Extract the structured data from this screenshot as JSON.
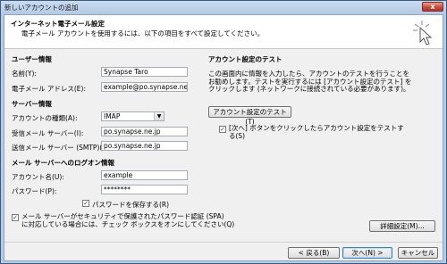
{
  "window": {
    "title": "新しいアカウントの追加",
    "close_label": "x"
  },
  "header": {
    "title": "インターネット電子メール設定",
    "description": "電子メール アカウントを使用するには、以下の項目をすべて設定してください。"
  },
  "user_info": {
    "heading": "ユーザー情報",
    "name_label": "名前(Y):",
    "name_value": "Synapse Taro",
    "email_label": "電子メール アドレス(E):",
    "email_value": "example@po.synapse.ne.jp"
  },
  "server_info": {
    "heading": "サーバー情報",
    "account_type_label": "アカウントの種類(A):",
    "account_type_value": "IMAP",
    "incoming_label": "受信メール サーバー(I):",
    "incoming_value": "po.synapse.ne.jp",
    "outgoing_label": "送信メール サーバー (SMTP)(O):",
    "outgoing_value": "po.synapse.ne.jp"
  },
  "login_info": {
    "heading": "メール サーバーへのログオン情報",
    "account_name_label": "アカウント名(U):",
    "account_name_value": "example",
    "password_label": "パスワード(P):",
    "password_value": "********",
    "remember_label": "パスワードを保存する(R)",
    "remember_checked": true,
    "spa_line1": "メール サーバーがセキュリティで保護されたパスワード認証 (SPA)",
    "spa_line2": "に対応している場合には、チェック ボックスをオンにしてください(Q)",
    "spa_checked": true
  },
  "test": {
    "heading": "アカウント設定のテスト",
    "desc_line1": "この画面内に情報を入力したら、アカウントのテストを行うことを",
    "desc_line2": "お勧めします。テストを実行するには [アカウント設定のテスト] を",
    "desc_line3": "クリックします (ネットワークに接続されている必要があります)。",
    "test_button": "アカウント設定のテスト(T)",
    "auto_test_line1": "[次へ] ボタンをクリックしたらアカウント設定をテストす",
    "auto_test_line2": "る(S)",
    "auto_test_checked": true
  },
  "more_settings_button": "詳細設定(M)...",
  "footer": {
    "back_button": "< 戻る(B)",
    "next_button": "次へ(N) >",
    "cancel_button": "キャンセル"
  }
}
